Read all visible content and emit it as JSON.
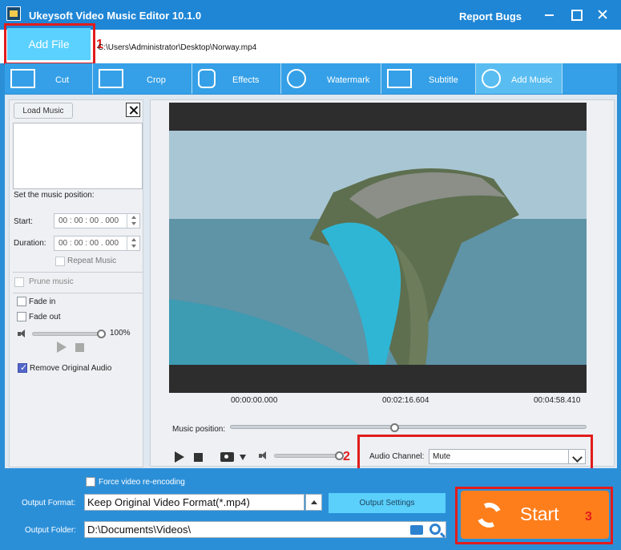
{
  "window": {
    "title": "Ukeysoft Video Music Editor 10.1.0",
    "report_bugs": "Report Bugs"
  },
  "file": {
    "add_file": "Add File",
    "path": "C:\\Users\\Administrator\\Desktop\\Norway.mp4",
    "marker": "1"
  },
  "tabs": [
    {
      "label": "Cut",
      "icon": "scissors-icon"
    },
    {
      "label": "Crop",
      "icon": "crop-icon"
    },
    {
      "label": "Effects",
      "icon": "stars-icon"
    },
    {
      "label": "Watermark",
      "icon": "drop-icon"
    },
    {
      "label": "Subtitle",
      "icon": "subtitle-icon"
    },
    {
      "label": "Add Music",
      "icon": "music-target-icon"
    }
  ],
  "music": {
    "load_music": "Load Music",
    "set_position": "Set the music position:",
    "start_label": "Start:",
    "start_value": "00 : 00 : 00 . 000",
    "duration_label": "Duration:",
    "duration_value": "00 : 00 : 00 . 000",
    "repeat_music": "Repeat Music",
    "prune_music": "Prune music",
    "fade_in": "Fade in",
    "fade_out": "Fade out",
    "volume_percent": "100%",
    "volume_level": 1.0,
    "remove_original_audio": "Remove Original Audio"
  },
  "preview": {
    "time_start": "00:00:00.000",
    "time_mid": "00:02:16.604",
    "time_end": "00:04:58.410",
    "music_position": "Music position:",
    "music_position_level": 0.46,
    "audio_channel_label": "Audio Channel:",
    "audio_channel_value": "Mute",
    "marker": "2",
    "volume_level": 0.95
  },
  "bottom": {
    "force_reencode": "Force video re-encoding",
    "output_format_label": "Output Format:",
    "output_format_value": "Keep Original Video Format(*.mp4)",
    "output_settings": "Output Settings",
    "output_folder_label": "Output Folder:",
    "output_folder_value": "D:\\Documents\\Videos\\",
    "start": "Start",
    "marker": "3"
  },
  "colors": {
    "primary_blue": "#2b8fd8",
    "add_file_cyan": "#5bd1ff",
    "start_orange": "#ff7e1c",
    "highlight_red": "#e21c1c"
  }
}
